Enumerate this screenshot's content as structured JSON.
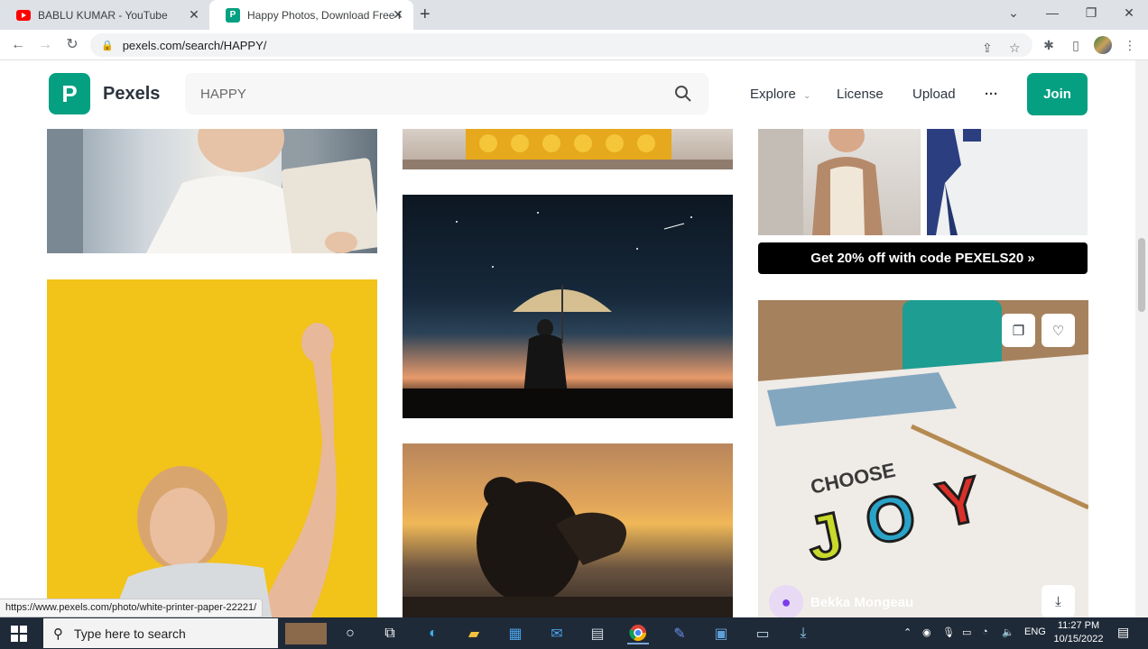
{
  "browser": {
    "tabs": [
      {
        "title": "BABLU KUMAR - YouTube",
        "favicon": "youtube-icon",
        "active": false
      },
      {
        "title": "Happy Photos, Download Free H",
        "favicon": "pexels-icon",
        "active": true
      }
    ],
    "url": "pexels.com/search/HAPPY/"
  },
  "pexels": {
    "brand": "Pexels",
    "logo_letter": "P",
    "search_value": "HAPPY",
    "nav": {
      "explore": "Explore",
      "license": "License",
      "upload": "Upload",
      "more": "···"
    },
    "join": "Join",
    "promo": "Get 20% off with code PEXELS20 »",
    "author": "Bekka Mongeau",
    "brand_color": "#05a081"
  },
  "status_url": "https://www.pexels.com/photo/white-printer-paper-22221/",
  "taskbar": {
    "search_placeholder": "Type here to search",
    "language": "ENG",
    "time": "11:27 PM",
    "date": "10/15/2022"
  }
}
